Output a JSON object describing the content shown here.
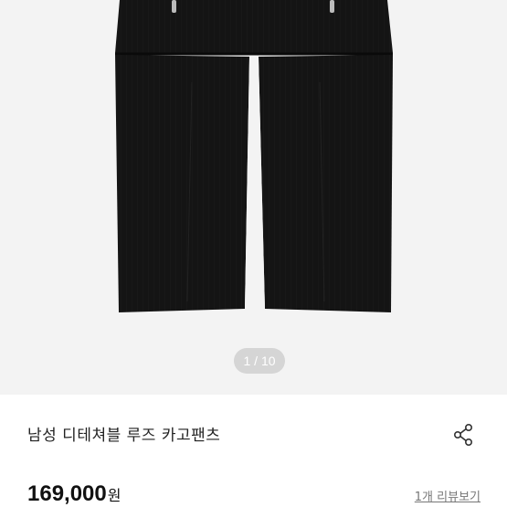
{
  "gallery": {
    "image_alt": "black pants",
    "counter": "1 / 10"
  },
  "product": {
    "title": "남성 디테쳐블 루즈 카고팬츠",
    "price": "169,000",
    "price_unit": "원",
    "review_link": "1개 리뷰보기"
  },
  "icons": {
    "share": "share-icon"
  }
}
